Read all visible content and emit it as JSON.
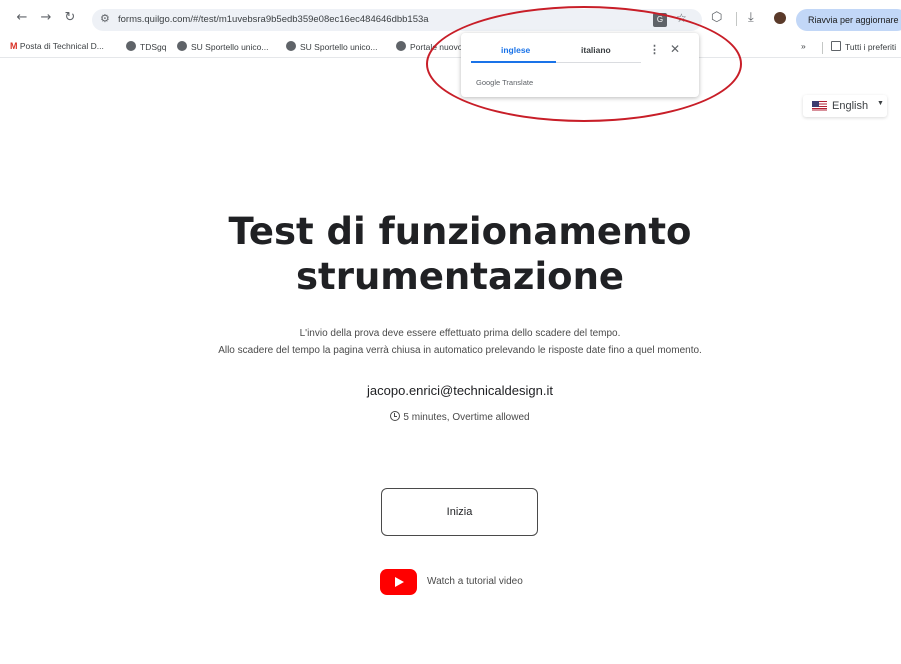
{
  "browser": {
    "url": "forms.quilgo.com/#/test/m1uvebsra9b5edb359e08ec16ec484646dbb153a",
    "update_label": "Riavvia per aggiornare",
    "bookmarks": [
      {
        "label": "Posta di Technical D...",
        "icon": "gmail-icon"
      },
      {
        "label": "TDSgq",
        "icon": "globe-icon"
      },
      {
        "label": "SU Sportello unico...",
        "icon": "globe-icon"
      },
      {
        "label": "SU Sportello unico...",
        "icon": "globe-icon"
      },
      {
        "label": "Portale nuovo",
        "icon": "globe-icon"
      }
    ],
    "overflow_label": "»",
    "all_bookmarks_label": "Tutti i preferiti"
  },
  "translate_popup": {
    "tab_source": "inglese",
    "tab_target": "italiano",
    "more_label": "⋮",
    "close_label": "✕",
    "brand": "Google Translate"
  },
  "page": {
    "language": "English",
    "title_line1": "Test di funzionamento",
    "title_line2": "strumentazione",
    "desc_line1": "L'invio della prova deve essere effettuato prima dello scadere del tempo.",
    "desc_line2": "Allo scadere del tempo la pagina verrà chiusa in automatico prelevando le risposte date fino a quel momento.",
    "email": "jacopo.enrici@technicaldesign.it",
    "duration": "5 minutes, Overtime allowed",
    "start_button": "Inizia",
    "tutorial_label": "Watch a tutorial video"
  },
  "colors": {
    "annotation": "#c81e28",
    "accent": "#1a73e8",
    "youtube": "#ff0000"
  }
}
